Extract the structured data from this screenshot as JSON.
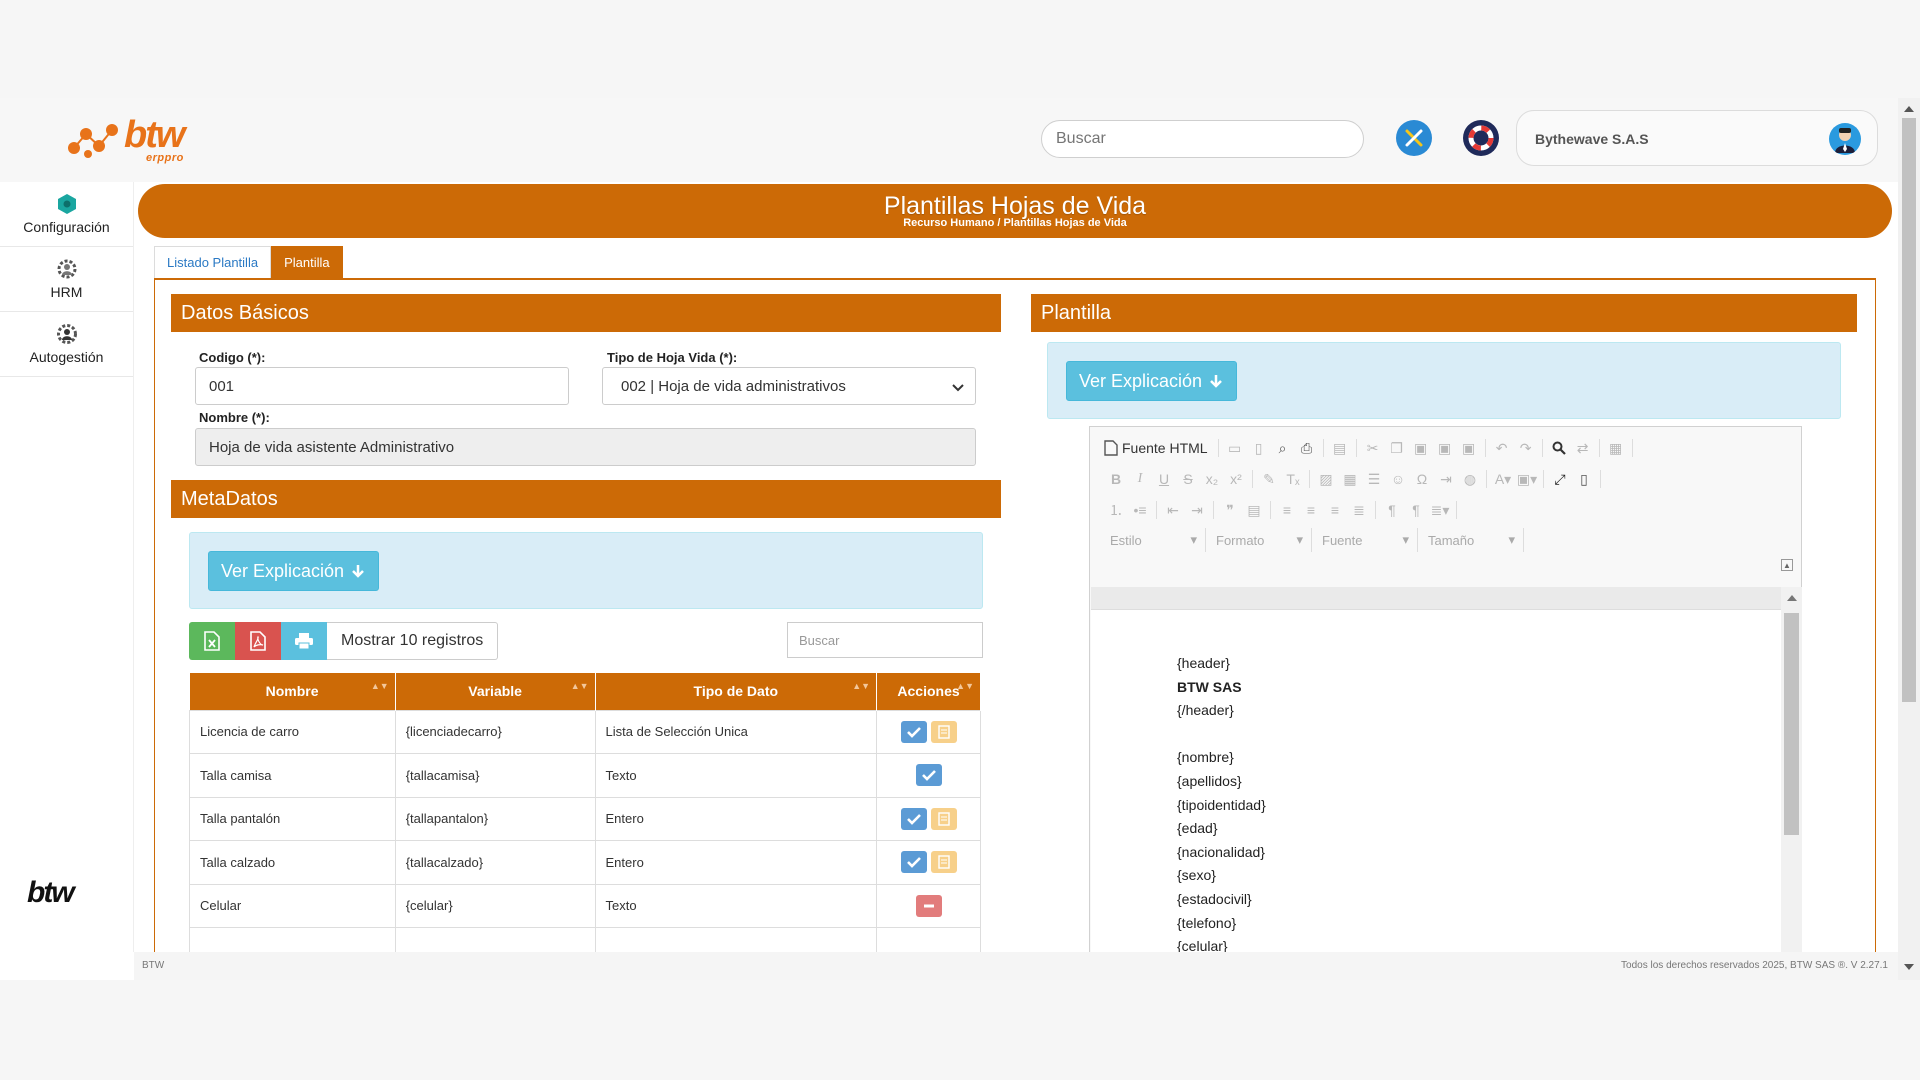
{
  "header": {
    "logo_text": "btw",
    "logo_sub": "erppro",
    "search_placeholder": "Buscar",
    "company": "Bythewave S.A.S"
  },
  "sidebar": {
    "items": [
      {
        "label": "Configuración"
      },
      {
        "label": "HRM"
      },
      {
        "label": "Autogestión"
      }
    ],
    "logo_text": "btw"
  },
  "banner": {
    "title": "Plantillas Hojas de Vida",
    "breadcrumb": "Recurso Humano / Plantillas Hojas de Vida"
  },
  "tabs": [
    {
      "label": "Listado Plantilla",
      "active": false
    },
    {
      "label": "Plantilla",
      "active": true
    }
  ],
  "basic": {
    "title": "Datos Básicos",
    "codigo_label": "Codigo (*):",
    "codigo_value": "001",
    "tipo_label": "Tipo de Hoja Vida (*):",
    "tipo_value": "002 | Hoja de vida administrativos",
    "nombre_label": "Nombre (*):",
    "nombre_value": "Hoja de vida asistente Administrativo"
  },
  "metadata": {
    "title": "MetaDatos",
    "explain_label": "Ver Explicación",
    "show_records": "Mostrar 10 registros",
    "search_placeholder": "Buscar",
    "columns": [
      "Nombre",
      "Variable",
      "Tipo de Dato",
      "Acciones"
    ],
    "rows": [
      {
        "nombre": "Licencia de carro",
        "variable": "{licenciadecarro}",
        "tipo": "Lista de Selección Unica",
        "actions": [
          "check",
          "doc"
        ]
      },
      {
        "nombre": "Talla camisa",
        "variable": "{tallacamisa}",
        "tipo": "Texto",
        "actions": [
          "check"
        ]
      },
      {
        "nombre": "Talla pantalón",
        "variable": "{tallapantalon}",
        "tipo": "Entero",
        "actions": [
          "check",
          "doc"
        ]
      },
      {
        "nombre": "Talla calzado",
        "variable": "{tallacalzado}",
        "tipo": "Entero",
        "actions": [
          "check",
          "doc"
        ]
      },
      {
        "nombre": "Celular",
        "variable": "{celular}",
        "tipo": "Texto",
        "actions": [
          "delete"
        ]
      },
      {
        "nombre": "",
        "variable": "",
        "tipo": "",
        "actions": []
      }
    ]
  },
  "plantilla": {
    "title": "Plantilla",
    "explain_label": "Ver Explicación",
    "toolbar": {
      "source_label": "Fuente HTML",
      "combo_estilo": "Estilo",
      "combo_formato": "Formato",
      "combo_fuente": "Fuente",
      "combo_tamano": "Tamaño"
    },
    "content_lines": [
      {
        "text": "{header}",
        "bold": false
      },
      {
        "text": "BTW SAS",
        "bold": true
      },
      {
        "text": "{/header}",
        "bold": false
      },
      {
        "text": "",
        "bold": false
      },
      {
        "text": "{nombre}",
        "bold": false
      },
      {
        "text": "{apellidos}",
        "bold": false
      },
      {
        "text": "{tipoidentidad}",
        "bold": false
      },
      {
        "text": "{edad}",
        "bold": false
      },
      {
        "text": "{nacionalidad}",
        "bold": false
      },
      {
        "text": "{sexo}",
        "bold": false
      },
      {
        "text": "{estadocivil}",
        "bold": false
      },
      {
        "text": "{telefono}",
        "bold": false
      },
      {
        "text": "{celular}",
        "bold": false
      }
    ]
  },
  "footer": {
    "left": "BTW",
    "right": "Todos los derechos reservados 2025, BTW SAS ®. V 2.27.1"
  },
  "colors": {
    "brand": "#cc6a06",
    "info": "#5bc0de",
    "info_bg": "#d9edf7"
  }
}
